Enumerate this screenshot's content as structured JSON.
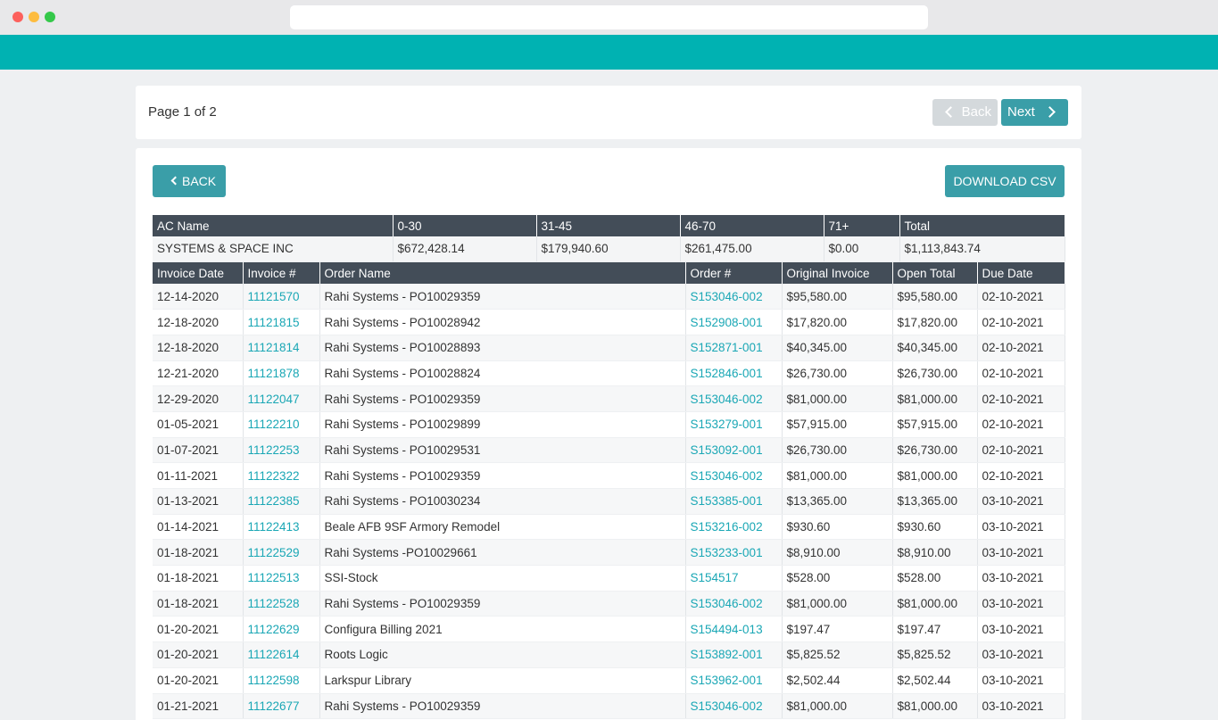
{
  "pager": {
    "text": "Page 1 of 2",
    "back_label": "Back",
    "next_label": "Next"
  },
  "toolbar": {
    "back_label": "BACK",
    "download_label": "DOWNLOAD CSV"
  },
  "summary": {
    "headers": [
      "AC Name",
      "0-30",
      "31-45",
      "46-70",
      "71+",
      "Total"
    ],
    "row": [
      "SYSTEMS & SPACE INC",
      "$672,428.14",
      "$179,940.60",
      "$261,475.00",
      "$0.00",
      "$1,113,843.74"
    ]
  },
  "invoices": {
    "headers": [
      "Invoice Date",
      "Invoice #",
      "Order Name",
      "Order #",
      "Original Invoice",
      "Open Total",
      "Due Date"
    ],
    "rows": [
      [
        "12-14-2020",
        "11121570",
        "Rahi Systems - PO10029359",
        "S153046-002",
        "$95,580.00",
        "$95,580.00",
        "02-10-2021"
      ],
      [
        "12-18-2020",
        "11121815",
        "Rahi Systems - PO10028942",
        "S152908-001",
        "$17,820.00",
        "$17,820.00",
        "02-10-2021"
      ],
      [
        "12-18-2020",
        "11121814",
        "Rahi Systems - PO10028893",
        "S152871-001",
        "$40,345.00",
        "$40,345.00",
        "02-10-2021"
      ],
      [
        "12-21-2020",
        "11121878",
        "Rahi Systems - PO10028824",
        "S152846-001",
        "$26,730.00",
        "$26,730.00",
        "02-10-2021"
      ],
      [
        "12-29-2020",
        "11122047",
        "Rahi Systems - PO10029359",
        "S153046-002",
        "$81,000.00",
        "$81,000.00",
        "02-10-2021"
      ],
      [
        "01-05-2021",
        "11122210",
        "Rahi Systems - PO10029899",
        "S153279-001",
        "$57,915.00",
        "$57,915.00",
        "02-10-2021"
      ],
      [
        "01-07-2021",
        "11122253",
        "Rahi Systems - PO10029531",
        "S153092-001",
        "$26,730.00",
        "$26,730.00",
        "02-10-2021"
      ],
      [
        "01-11-2021",
        "11122322",
        "Rahi Systems - PO10029359",
        "S153046-002",
        "$81,000.00",
        "$81,000.00",
        "02-10-2021"
      ],
      [
        "01-13-2021",
        "11122385",
        "Rahi Systems - PO10030234",
        "S153385-001",
        "$13,365.00",
        "$13,365.00",
        "03-10-2021"
      ],
      [
        "01-14-2021",
        "11122413",
        "Beale AFB 9SF Armory Remodel",
        "S153216-002",
        "$930.60",
        "$930.60",
        "03-10-2021"
      ],
      [
        "01-18-2021",
        "11122529",
        "Rahi Systems -PO10029661",
        "S153233-001",
        "$8,910.00",
        "$8,910.00",
        "03-10-2021"
      ],
      [
        "01-18-2021",
        "11122513",
        "SSI-Stock",
        "S154517",
        "$528.00",
        "$528.00",
        "03-10-2021"
      ],
      [
        "01-18-2021",
        "11122528",
        "Rahi Systems - PO10029359",
        "S153046-002",
        "$81,000.00",
        "$81,000.00",
        "03-10-2021"
      ],
      [
        "01-20-2021",
        "11122629",
        "Configura Billing 2021",
        "S154494-013",
        "$197.47",
        "$197.47",
        "03-10-2021"
      ],
      [
        "01-20-2021",
        "11122614",
        "Roots Logic",
        "S153892-001",
        "$5,825.52",
        "$5,825.52",
        "03-10-2021"
      ],
      [
        "01-20-2021",
        "11122598",
        "Larkspur Library",
        "S153962-001",
        "$2,502.44",
        "$2,502.44",
        "03-10-2021"
      ],
      [
        "01-21-2021",
        "11122677",
        "Rahi Systems - PO10029359",
        "S153046-002",
        "$81,000.00",
        "$81,000.00",
        "03-10-2021"
      ]
    ]
  }
}
